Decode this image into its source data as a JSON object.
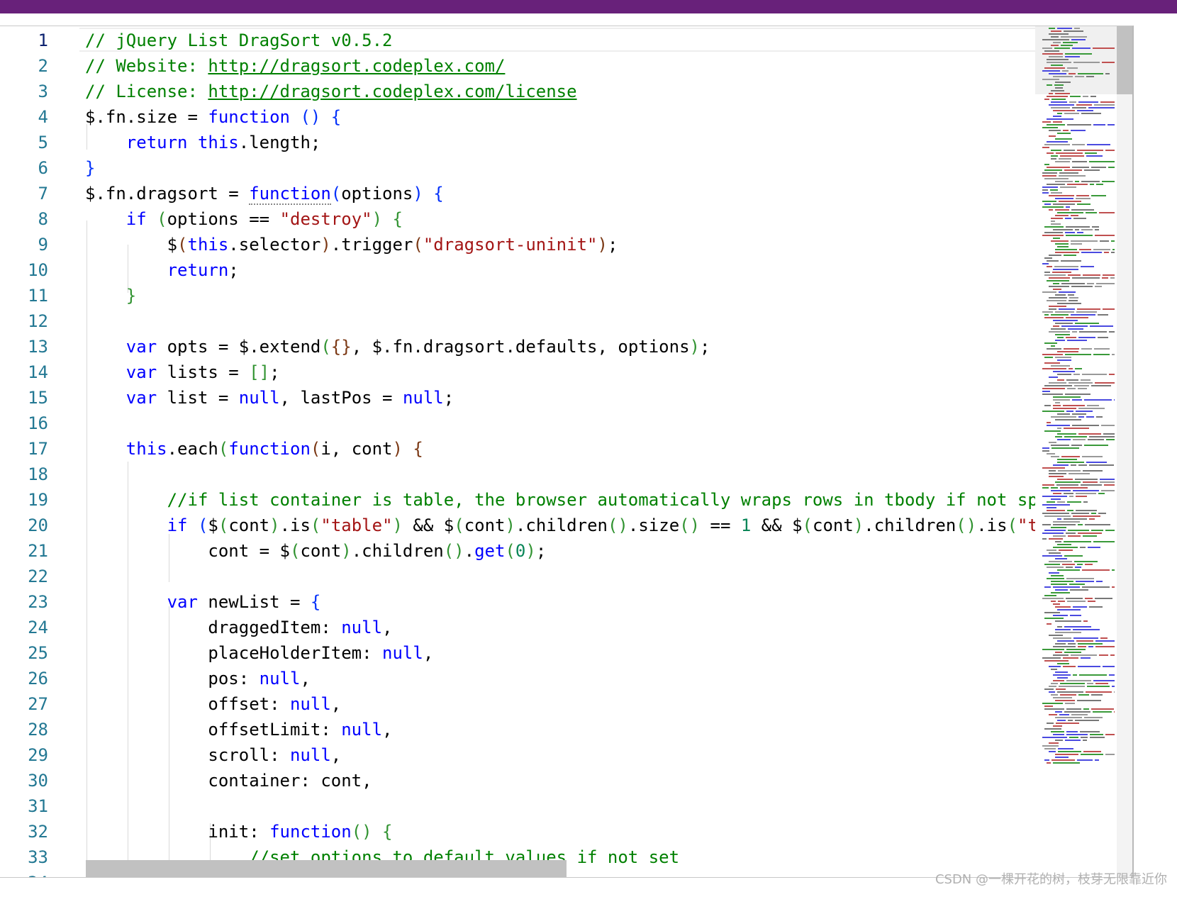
{
  "editor": {
    "active_line": 1,
    "lines": [
      {
        "n": "1",
        "tokens": [
          {
            "t": "// jQuery List DragSort v0.5.2",
            "c": "cm"
          }
        ]
      },
      {
        "n": "2",
        "tokens": [
          {
            "t": "// Website: ",
            "c": "cm"
          },
          {
            "t": "http://dragsort.codeplex.com/",
            "c": "lnk"
          }
        ]
      },
      {
        "n": "3",
        "tokens": [
          {
            "t": "// License: ",
            "c": "cm"
          },
          {
            "t": "http://dragsort.codeplex.com/license",
            "c": "lnk"
          }
        ]
      },
      {
        "n": "4",
        "tokens": [
          {
            "t": "$.fn.size = "
          },
          {
            "t": "function",
            "c": "kw"
          },
          {
            "t": " ",
            "c": ""
          },
          {
            "t": "()",
            "c": "pb"
          },
          {
            "t": " "
          },
          {
            "t": "{",
            "c": "pb"
          }
        ]
      },
      {
        "n": "5",
        "tokens": [
          {
            "t": "    "
          },
          {
            "t": "return",
            "c": "kw"
          },
          {
            "t": " "
          },
          {
            "t": "this",
            "c": "kw"
          },
          {
            "t": ".length;"
          }
        ]
      },
      {
        "n": "6",
        "tokens": [
          {
            "t": "}",
            "c": "pb"
          }
        ]
      },
      {
        "n": "7",
        "tokens": [
          {
            "t": "$.fn.dragsort = "
          },
          {
            "t": "function",
            "c": "kw dots"
          },
          {
            "t": "(",
            "c": "pb"
          },
          {
            "t": "options"
          },
          {
            "t": ")",
            "c": "pb"
          },
          {
            "t": " "
          },
          {
            "t": "{",
            "c": "pb"
          }
        ]
      },
      {
        "n": "8",
        "tokens": [
          {
            "t": "    "
          },
          {
            "t": "if",
            "c": "kw"
          },
          {
            "t": " "
          },
          {
            "t": "(",
            "c": "pg"
          },
          {
            "t": "options == "
          },
          {
            "t": "\"destroy\"",
            "c": "st"
          },
          {
            "t": ")",
            "c": "pg"
          },
          {
            "t": " "
          },
          {
            "t": "{",
            "c": "pg"
          }
        ]
      },
      {
        "n": "9",
        "tokens": [
          {
            "t": "        $"
          },
          {
            "t": "(",
            "c": "pr"
          },
          {
            "t": "this",
            "c": "kw"
          },
          {
            "t": ".selector"
          },
          {
            "t": ")",
            "c": "pr"
          },
          {
            "t": ".trigger"
          },
          {
            "t": "(",
            "c": "pr"
          },
          {
            "t": "\"dragsort-uninit\"",
            "c": "st"
          },
          {
            "t": ")",
            "c": "pr"
          },
          {
            "t": ";"
          }
        ]
      },
      {
        "n": "10",
        "tokens": [
          {
            "t": "        "
          },
          {
            "t": "return",
            "c": "kw"
          },
          {
            "t": ";"
          }
        ]
      },
      {
        "n": "11",
        "tokens": [
          {
            "t": "    "
          },
          {
            "t": "}",
            "c": "pg"
          }
        ]
      },
      {
        "n": "12",
        "tokens": []
      },
      {
        "n": "13",
        "tokens": [
          {
            "t": "    "
          },
          {
            "t": "var",
            "c": "kw"
          },
          {
            "t": " opts = $.extend"
          },
          {
            "t": "(",
            "c": "pg"
          },
          {
            "t": "{}",
            "c": "pr"
          },
          {
            "t": ", $.fn.dragsort.defaults, options"
          },
          {
            "t": ")",
            "c": "pg"
          },
          {
            "t": ";"
          }
        ]
      },
      {
        "n": "14",
        "tokens": [
          {
            "t": "    "
          },
          {
            "t": "var",
            "c": "kw"
          },
          {
            "t": " lists = "
          },
          {
            "t": "[]",
            "c": "pg"
          },
          {
            "t": ";"
          }
        ]
      },
      {
        "n": "15",
        "tokens": [
          {
            "t": "    "
          },
          {
            "t": "var",
            "c": "kw"
          },
          {
            "t": " list = "
          },
          {
            "t": "null",
            "c": "kw"
          },
          {
            "t": ", lastPos = "
          },
          {
            "t": "null",
            "c": "kw"
          },
          {
            "t": ";"
          }
        ]
      },
      {
        "n": "16",
        "tokens": []
      },
      {
        "n": "17",
        "tokens": [
          {
            "t": "    "
          },
          {
            "t": "this",
            "c": "kw"
          },
          {
            "t": ".each"
          },
          {
            "t": "(",
            "c": "pg"
          },
          {
            "t": "function",
            "c": "kw"
          },
          {
            "t": "(",
            "c": "pr"
          },
          {
            "t": "i, cont"
          },
          {
            "t": ")",
            "c": "pr"
          },
          {
            "t": " "
          },
          {
            "t": "{",
            "c": "pr"
          }
        ]
      },
      {
        "n": "18",
        "tokens": []
      },
      {
        "n": "19",
        "tokens": [
          {
            "t": "        "
          },
          {
            "t": "//if list container is table, the browser automatically wraps rows in tbody if not sp",
            "c": "cm"
          }
        ]
      },
      {
        "n": "20",
        "tokens": [
          {
            "t": "        "
          },
          {
            "t": "if",
            "c": "kw"
          },
          {
            "t": " "
          },
          {
            "t": "(",
            "c": "pb"
          },
          {
            "t": "$"
          },
          {
            "t": "(",
            "c": "pg"
          },
          {
            "t": "cont"
          },
          {
            "t": ")",
            "c": "pg"
          },
          {
            "t": ".is"
          },
          {
            "t": "(",
            "c": "pg"
          },
          {
            "t": "\"table\"",
            "c": "st"
          },
          {
            "t": ")",
            "c": "pg"
          },
          {
            "t": " && $"
          },
          {
            "t": "(",
            "c": "pg"
          },
          {
            "t": "cont"
          },
          {
            "t": ")",
            "c": "pg"
          },
          {
            "t": ".children"
          },
          {
            "t": "()",
            "c": "pg"
          },
          {
            "t": ".size"
          },
          {
            "t": "()",
            "c": "pg"
          },
          {
            "t": " == "
          },
          {
            "t": "1",
            "c": "nm"
          },
          {
            "t": " && $"
          },
          {
            "t": "(",
            "c": "pg"
          },
          {
            "t": "cont"
          },
          {
            "t": ")",
            "c": "pg"
          },
          {
            "t": ".children"
          },
          {
            "t": "()",
            "c": "pg"
          },
          {
            "t": ".is"
          },
          {
            "t": "(",
            "c": "pg"
          },
          {
            "t": "\"t",
            "c": "st"
          }
        ]
      },
      {
        "n": "21",
        "tokens": [
          {
            "t": "            cont = $"
          },
          {
            "t": "(",
            "c": "pg"
          },
          {
            "t": "cont"
          },
          {
            "t": ")",
            "c": "pg"
          },
          {
            "t": ".children"
          },
          {
            "t": "()",
            "c": "pg"
          },
          {
            "t": "."
          },
          {
            "t": "get",
            "c": "kw"
          },
          {
            "t": "(",
            "c": "pg"
          },
          {
            "t": "0",
            "c": "nm"
          },
          {
            "t": ")",
            "c": "pg"
          },
          {
            "t": ";"
          }
        ]
      },
      {
        "n": "22",
        "tokens": []
      },
      {
        "n": "23",
        "tokens": [
          {
            "t": "        "
          },
          {
            "t": "var",
            "c": "kw"
          },
          {
            "t": " newList = "
          },
          {
            "t": "{",
            "c": "pb"
          }
        ]
      },
      {
        "n": "24",
        "tokens": [
          {
            "t": "            draggedItem: "
          },
          {
            "t": "null",
            "c": "kw"
          },
          {
            "t": ","
          }
        ]
      },
      {
        "n": "25",
        "tokens": [
          {
            "t": "            placeHolderItem: "
          },
          {
            "t": "null",
            "c": "kw"
          },
          {
            "t": ","
          }
        ]
      },
      {
        "n": "26",
        "tokens": [
          {
            "t": "            pos: "
          },
          {
            "t": "null",
            "c": "kw"
          },
          {
            "t": ","
          }
        ]
      },
      {
        "n": "27",
        "tokens": [
          {
            "t": "            offset: "
          },
          {
            "t": "null",
            "c": "kw"
          },
          {
            "t": ","
          }
        ]
      },
      {
        "n": "28",
        "tokens": [
          {
            "t": "            offsetLimit: "
          },
          {
            "t": "null",
            "c": "kw"
          },
          {
            "t": ","
          }
        ]
      },
      {
        "n": "29",
        "tokens": [
          {
            "t": "            scroll: "
          },
          {
            "t": "null",
            "c": "kw"
          },
          {
            "t": ","
          }
        ]
      },
      {
        "n": "30",
        "tokens": [
          {
            "t": "            container: cont,"
          }
        ]
      },
      {
        "n": "31",
        "tokens": []
      },
      {
        "n": "32",
        "tokens": [
          {
            "t": "            init: "
          },
          {
            "t": "function",
            "c": "kw"
          },
          {
            "t": "()",
            "c": "pg"
          },
          {
            "t": " "
          },
          {
            "t": "{",
            "c": "pg"
          }
        ]
      },
      {
        "n": "33",
        "tokens": [
          {
            "t": "                "
          },
          {
            "t": "//set options to default values if not set",
            "c": "cm"
          }
        ]
      },
      {
        "n": "34",
        "tokens": []
      }
    ]
  },
  "watermark": "CSDN @一棵开花的树，枝芽无限靠近你"
}
